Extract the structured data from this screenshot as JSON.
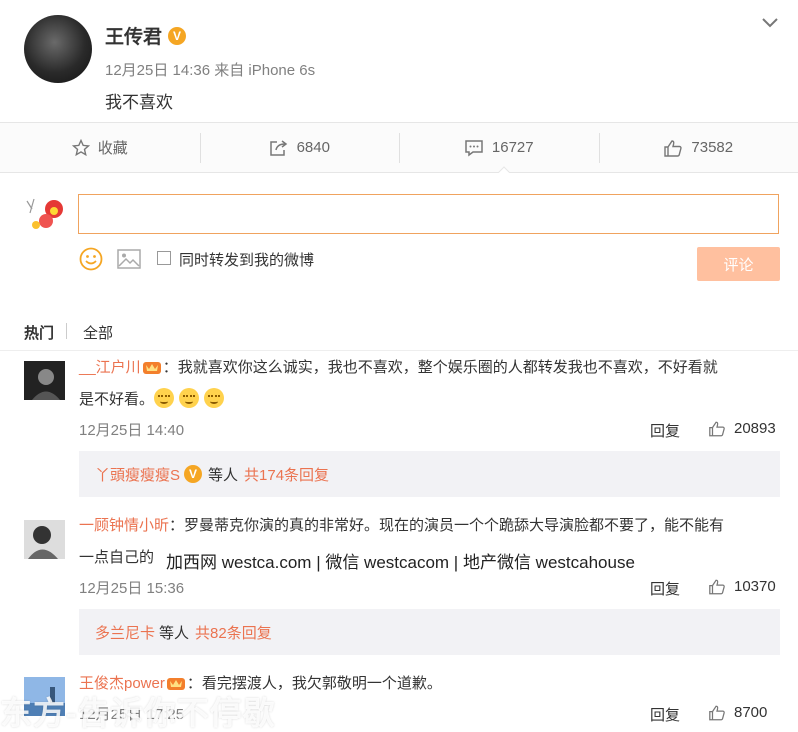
{
  "post": {
    "author": "王传君",
    "verified_badge": "V",
    "meta": "12月25日 14:36 来自 iPhone 6s",
    "text": "我不喜欢"
  },
  "actions": {
    "favorite": "收藏",
    "repost": "6840",
    "comment": "16727",
    "like": "73582"
  },
  "composer": {
    "input_value": "",
    "forward_label": "同时转发到我的微博",
    "submit": "评论"
  },
  "tabs": {
    "hot": "热门",
    "all": "全部"
  },
  "comments": [
    {
      "user": "__江户川",
      "text_line1": "：我就喜欢你这么诚实，我也不喜欢，整个娱乐圈的人都转发我也不喜欢，不好看就",
      "text_line2": "是不好看。",
      "time": "12月25日 14:40",
      "reply": "回复",
      "likes": "20893",
      "sub_user": "丫頭瘦瘦瘦S",
      "sub_badge": "V",
      "sub_etc": "等人",
      "sub_count": "共174条回复"
    },
    {
      "user": "一顾钟情小昕",
      "text_line1": "：罗曼蒂克你演的真的非常好。现在的演员一个个跪舔大导演脸都不要了，能不能有",
      "text_line2": "一点自己的",
      "time": "12月25日 15:36",
      "reply": "回复",
      "likes": "10370",
      "sub_user": "多兰尼卡",
      "sub_etc": "等人",
      "sub_count": "共82条回复"
    },
    {
      "user": "王俊杰power",
      "text_line1": "：看完摆渡人，我欠郭敬明一个道歉。",
      "time": "12月25日 17:25",
      "reply": "回复",
      "likes": "8700"
    }
  ],
  "watermark": "加西网 westca.com | 微信 westcacom | 地产微信 westcahouse",
  "bottom_watermark": "东方-告诉你不停歇",
  "colors": {
    "accent": "#eb7350",
    "submit_bg": "#ffc09f",
    "verified": "#f5a623"
  }
}
